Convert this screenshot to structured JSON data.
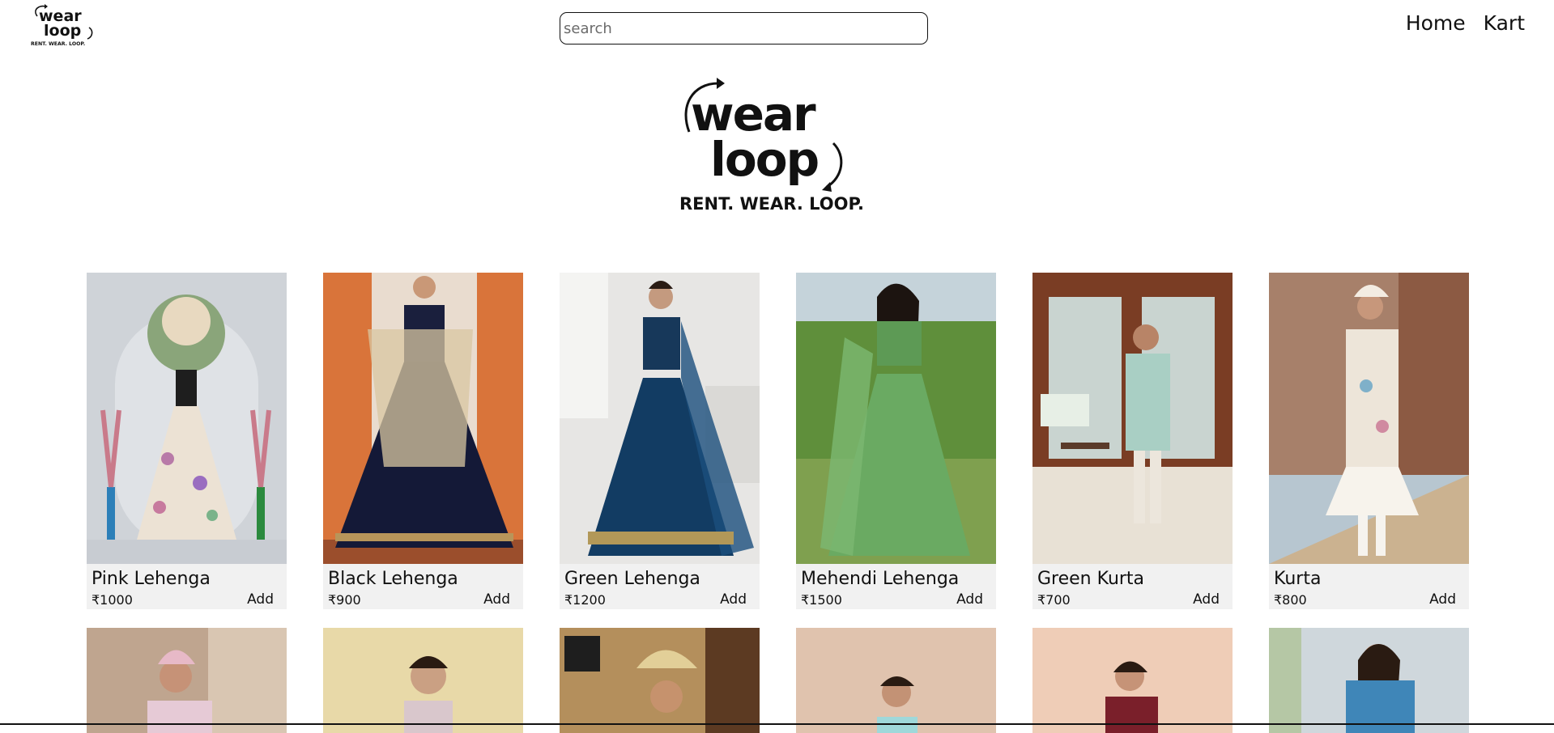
{
  "brand": {
    "logo_word_1": "wear",
    "logo_word_2": "loop",
    "tagline": "RENT. WEAR. LOOP."
  },
  "search": {
    "placeholder": "search",
    "value": ""
  },
  "nav": {
    "home": "Home",
    "kart": "Kart"
  },
  "products": [
    {
      "name": "Pink Lehenga",
      "price": "₹1000",
      "add_label": "Add"
    },
    {
      "name": "Black Lehenga",
      "price": "₹900",
      "add_label": "Add"
    },
    {
      "name": "Green Lehenga",
      "price": "₹1200",
      "add_label": "Add"
    },
    {
      "name": "Mehendi Lehenga",
      "price": "₹1500",
      "add_label": "Add"
    },
    {
      "name": "Green Kurta",
      "price": "₹700",
      "add_label": "Add"
    },
    {
      "name": "Kurta",
      "price": "₹800",
      "add_label": "Add"
    }
  ],
  "colors": {
    "card_bg": "#f1f1f1",
    "text": "#111111"
  }
}
